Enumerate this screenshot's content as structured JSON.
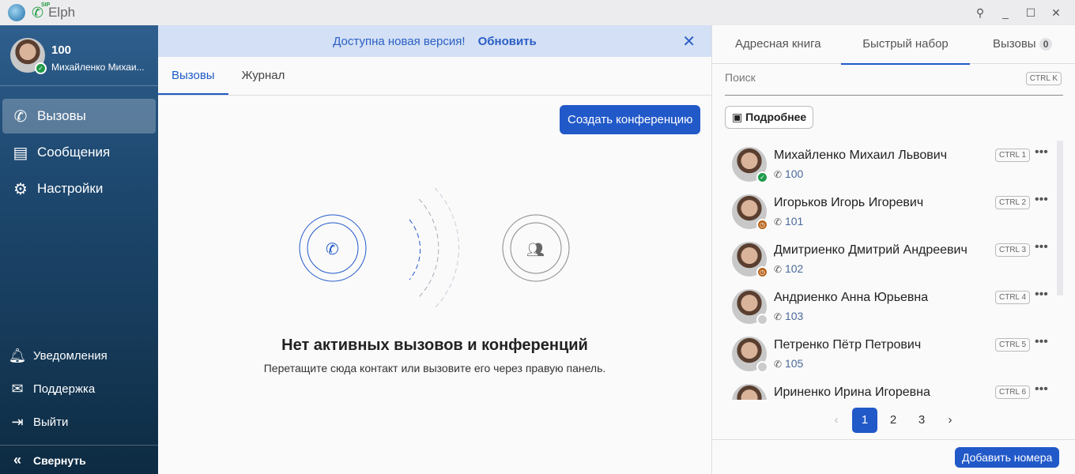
{
  "app": {
    "title": "Elph",
    "sip_label": "SIP"
  },
  "user": {
    "number": "100",
    "name": "Михайленко Михаи..."
  },
  "sidebar": {
    "items": [
      {
        "label": "Вызовы",
        "icon": "phone-icon"
      },
      {
        "label": "Сообщения",
        "icon": "message-icon"
      },
      {
        "label": "Настройки",
        "icon": "gear-icon"
      }
    ],
    "bottom": [
      {
        "label": "Уведомления",
        "icon": "bell-icon"
      },
      {
        "label": "Поддержка",
        "icon": "mail-icon"
      },
      {
        "label": "Выйти",
        "icon": "logout-icon"
      }
    ],
    "collapse": "Свернуть"
  },
  "banner": {
    "text": "Доступна новая версия!",
    "link": "Обновить"
  },
  "main": {
    "tabs": [
      "Вызовы",
      "Журнал"
    ],
    "create_conference": "Создать конференцию",
    "empty_title": "Нет активных вызовов и конференций",
    "empty_subtitle": "Перетащите сюда контакт или вызовите его через правую панель."
  },
  "right": {
    "tabs": [
      "Адресная книга",
      "Быстрый набор",
      "Вызовы"
    ],
    "calls_count": "0",
    "search_placeholder": "Поиск",
    "search_shortcut": "CTRL K",
    "details": "Подробнее",
    "contacts": [
      {
        "name": "Михайленко Михаил Львович",
        "phone": "100",
        "shortcut": "CTRL 1",
        "status": "online"
      },
      {
        "name": "Игорьков Игорь Игоревич",
        "phone": "101",
        "shortcut": "CTRL 2",
        "status": "away"
      },
      {
        "name": "Дмитриенко Дмитрий Андреевич",
        "phone": "102",
        "shortcut": "CTRL 3",
        "status": "away"
      },
      {
        "name": "Андриенко Анна Юрьевна",
        "phone": "103",
        "shortcut": "CTRL 4",
        "status": "offline"
      },
      {
        "name": "Петренко Пётр Петрович",
        "phone": "105",
        "shortcut": "CTRL 5",
        "status": "offline"
      },
      {
        "name": "Ириненко Ирина Игоревна",
        "phone": "",
        "shortcut": "CTRL 6",
        "status": "offline"
      }
    ],
    "pages": [
      "1",
      "2",
      "3"
    ],
    "current_page": "1",
    "add_numbers": "Добавить номера"
  },
  "colors": {
    "accent": "#2259c9",
    "online": "#1f9a4a",
    "away": "#b8641c",
    "offline": "#cccccc"
  }
}
